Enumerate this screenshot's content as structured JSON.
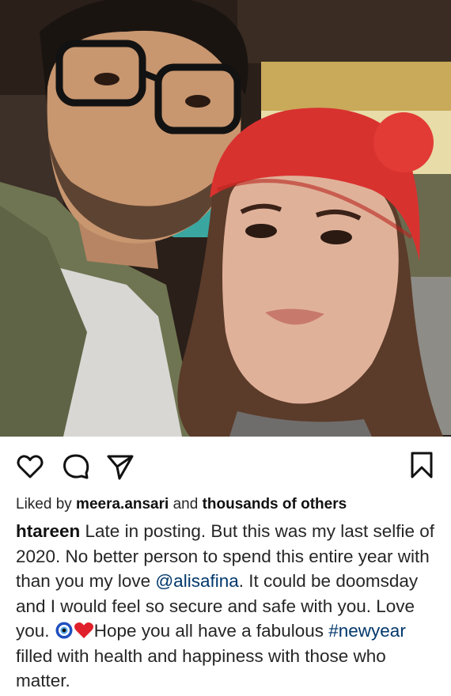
{
  "post": {
    "image_alt": "selfie",
    "liked_by_prefix": "Liked by ",
    "liked_by_user": "meera.ansari",
    "liked_by_middle": " and ",
    "liked_by_others": "thousands of others",
    "author": "htareen",
    "caption_part1": " Late in posting. But this was my last selfie of 2020. No better person to spend this entire year with than you my love ",
    "mention": "@alisafina",
    "caption_part2": ". It could be doomsday and I would feel so secure and safe with you. Love you. ",
    "caption_part3": "Hope you all have a fabulous ",
    "hashtag": "#newyear",
    "caption_part4": " filled with health and happiness with those who matter.",
    "emojis": [
      "nazar-amulet",
      "red-heart"
    ]
  },
  "actions": {
    "icons": [
      "heart-icon",
      "comment-icon",
      "share-icon",
      "bookmark-icon"
    ]
  },
  "colors": {
    "link": "#00376b",
    "text": "#262626",
    "hat_red": "#d8322f"
  }
}
